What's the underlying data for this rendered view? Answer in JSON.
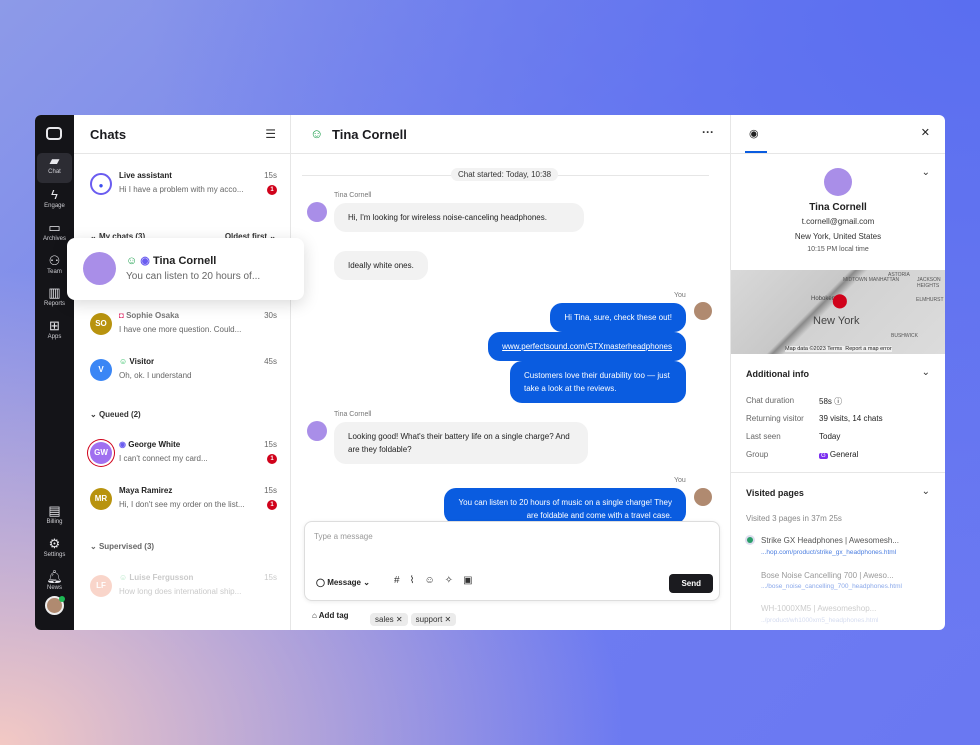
{
  "sidebar": {
    "items": [
      {
        "label": "Chat",
        "icon": "chat-icon"
      },
      {
        "label": "Engage",
        "icon": "bolt-icon"
      },
      {
        "label": "Archives",
        "icon": "archive-icon"
      },
      {
        "label": "Team",
        "icon": "team-icon"
      },
      {
        "label": "Reports",
        "icon": "chart-icon"
      },
      {
        "label": "Apps",
        "icon": "apps-icon"
      }
    ],
    "bottom": [
      {
        "label": "Billing",
        "icon": "billing-icon"
      },
      {
        "label": "Settings",
        "icon": "gear-icon"
      },
      {
        "label": "News",
        "icon": "bell-icon"
      }
    ]
  },
  "chats": {
    "title": "Chats",
    "live": {
      "name": "Live assistant",
      "preview": "Hi I have a problem with my acco...",
      "time": "15s",
      "badge": "1"
    },
    "my_chats": {
      "label": "My chats (3)",
      "sort": "Oldest first"
    },
    "popup": {
      "name": "Tina Cornell",
      "preview": "You can listen to 20 hours of..."
    },
    "mine": [
      {
        "initials": "SO",
        "name": "Sophie Osaka",
        "preview": "I have one more question. Could...",
        "time": "30s"
      },
      {
        "initials": "V",
        "name": "Visitor",
        "preview": "Oh, ok. I understand",
        "time": "45s"
      }
    ],
    "queued": {
      "label": "Queued (2)",
      "items": [
        {
          "initials": "GW",
          "name": "George White",
          "preview": "I can't connect my card...",
          "time": "15s",
          "badge": "1"
        },
        {
          "initials": "MR",
          "name": "Maya Ramirez",
          "preview": "Hi, I don't see my order on the list...",
          "time": "15s",
          "badge": "1"
        }
      ]
    },
    "supervised": {
      "label": "Supervised (3)",
      "items": [
        {
          "initials": "LF",
          "name": "Luise  Fergusson",
          "preview": "How long does international ship...",
          "time": "15s"
        }
      ]
    }
  },
  "conversation": {
    "title": "Tina Cornell",
    "started": "Chat started: Today, 10:38",
    "customer": "Tina Cornell",
    "you": "You",
    "m1": "Hi, I'm looking for wireless noise-canceling headphones.",
    "m2": "Ideally white ones.",
    "r1": "Hi Tina, sure, check these out!",
    "r2": "www.perfectsound.com/GTXmasterheadphones",
    "r3": "Customers love their durability too — just take a look at the reviews.",
    "m3": "Looking good! What's their battery life on a single charge? And are they foldable?",
    "r4": "You can listen to 20 hours of music on a single charge! They are foldable and come with a travel case.",
    "composer": {
      "placeholder": "Type a message",
      "mode": "Message",
      "send": "Send"
    },
    "tags": {
      "add": "Add tag",
      "items": [
        "sales",
        "support"
      ]
    }
  },
  "profile": {
    "name": "Tina Cornell",
    "email": "t.cornell@gmail.com",
    "location": "New York, United States",
    "local_time": "10:15 PM local time",
    "map": {
      "city": "New York",
      "labels": [
        "MIDTOWN MANHATTAN",
        "ASTORIA",
        "JACKSON HEIGHTS",
        "Hoboken",
        "ELMHURST",
        "BUSHWICK"
      ],
      "footer": "Map data ©2023",
      "terms": "Terms",
      "report": "Report a map error"
    },
    "additional": {
      "title": "Additional info",
      "rows": [
        {
          "k": "Chat duration",
          "v": "58s"
        },
        {
          "k": "Returning visitor",
          "v": "39 visits, 14 chats"
        },
        {
          "k": "Last seen",
          "v": "Today"
        },
        {
          "k": "Group",
          "v": "General"
        }
      ]
    },
    "visited": {
      "title": "Visited pages",
      "summary": "Visited 3 pages in 37m 25s",
      "pages": [
        {
          "t": "Strike GX Headphones | Awesomesh...",
          "u": "...hop.com/product/strike_gx_headphones.html"
        },
        {
          "t": "Bose Noise Cancelling 700 | Aweso...",
          "u": ".../bose_noise_cancelling_700_headphones.html"
        },
        {
          "t": "WH-1000XM5 | Awesomeshop...",
          "u": "../product/wh1000xm5_headphones.html"
        }
      ]
    }
  }
}
